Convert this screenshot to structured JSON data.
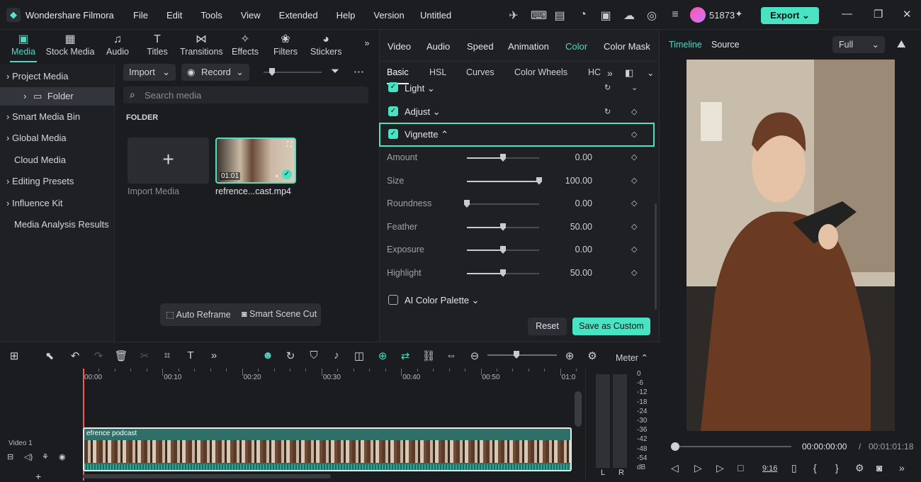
{
  "app": {
    "name": "Wondershare Filmora",
    "document_title": "Untitled",
    "credits": "51873",
    "export_label": "Export"
  },
  "menu": [
    "File",
    "Edit",
    "Tools",
    "View",
    "Extended",
    "Help",
    "Version"
  ],
  "media_tabs": [
    "Media",
    "Stock Media",
    "Audio",
    "Titles",
    "Transitions",
    "Effects",
    "Filters",
    "Stickers"
  ],
  "sidebar": {
    "items": [
      "Project Media",
      "Folder",
      "Smart Media Bin",
      "Global Media",
      "Cloud Media",
      "Editing Presets",
      "Influence Kit",
      "Media Analysis Results"
    ]
  },
  "library": {
    "import_label": "Import",
    "record_label": "Record",
    "search_placeholder": "Search media",
    "folder_heading": "FOLDER",
    "import_media_label": "Import Media",
    "clip_name": "refrence...cast.mp4",
    "clip_duration": "01:01",
    "auto_reframe": "Auto Reframe",
    "smart_scene_cut": "Smart Scene Cut"
  },
  "property": {
    "tabs": [
      "Video",
      "Audio",
      "Speed",
      "Animation",
      "Color",
      "Color Mask"
    ],
    "active_tab": "Color",
    "subtabs": [
      "Basic",
      "HSL",
      "Curves",
      "Color Wheels",
      "HC"
    ],
    "sections": {
      "light": "Light",
      "adjust": "Adjust",
      "vignette": "Vignette",
      "ai_palette": "AI Color Palette"
    },
    "vignette_rows": [
      {
        "label": "Amount",
        "value": "0.00",
        "level": 0.5
      },
      {
        "label": "Size",
        "value": "100.00",
        "level": 1.0
      },
      {
        "label": "Roundness",
        "value": "0.00",
        "level": 0.0
      },
      {
        "label": "Feather",
        "value": "50.00",
        "level": 0.5
      },
      {
        "label": "Exposure",
        "value": "0.00",
        "level": 0.5
      },
      {
        "label": "Highlight",
        "value": "50.00",
        "level": 0.5
      }
    ],
    "reset_label": "Reset",
    "save_label": "Save as Custom"
  },
  "preview": {
    "tab_timeline": "Timeline",
    "tab_source": "Source",
    "quality": "Full",
    "current_time": "00:00:00:00",
    "separator": "/",
    "total_time": "00:01:01:18",
    "aspect_label": "9:16"
  },
  "timeline": {
    "ruler": [
      "00:00",
      "00:10",
      "00:20",
      "00:30",
      "00:40",
      "00:50",
      "01:0"
    ],
    "track_label": "Video 1",
    "clip_label": "efrence podcast",
    "meter_label": "Meter",
    "db_scale": [
      "0",
      "-6",
      "-12",
      "-18",
      "-24",
      "-30",
      "-36",
      "-42",
      "-48",
      "-54",
      "dB"
    ],
    "meter_channels": [
      "L",
      "R"
    ]
  },
  "colors": {
    "accent": "#49e3c4",
    "playhead": "#ef5a5a",
    "background": "#1b1c20"
  }
}
